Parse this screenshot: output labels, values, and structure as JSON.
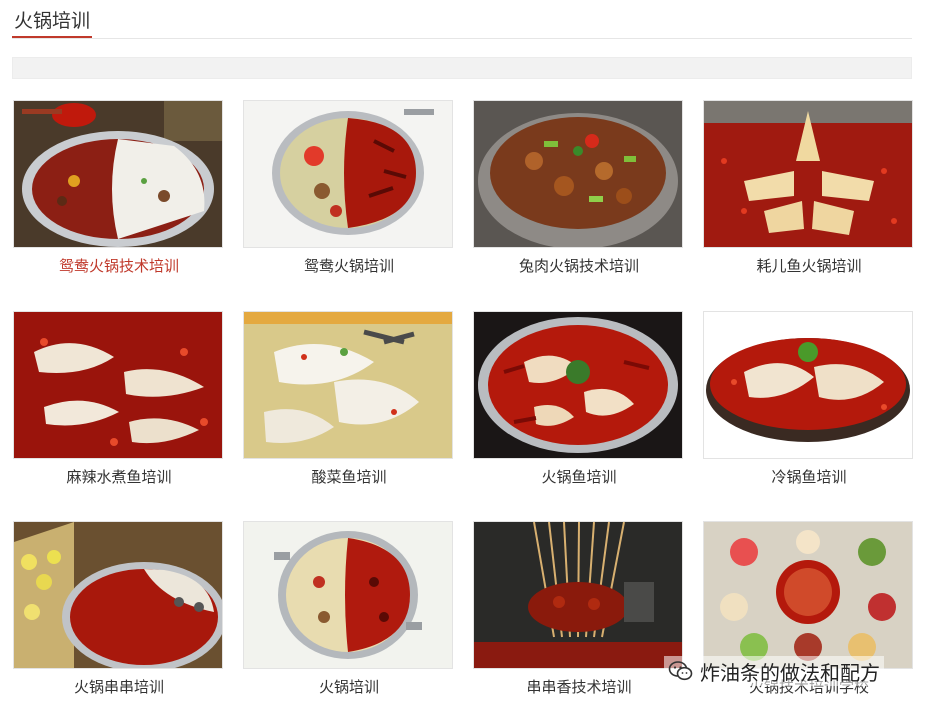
{
  "header": {
    "title": "火锅培训"
  },
  "items": [
    {
      "label": "鸳鸯火锅技术培训",
      "image": "yuanyang-hotpot-photo"
    },
    {
      "label": "鸳鸯火锅培训",
      "image": "yuanyang-pot-photo"
    },
    {
      "label": "兔肉火锅技术培训",
      "image": "rabbit-hotpot-photo"
    },
    {
      "label": "耗儿鱼火锅培训",
      "image": "haoer-fish-hotpot-photo"
    },
    {
      "label": "麻辣水煮鱼培训",
      "image": "spicy-boiled-fish-photo"
    },
    {
      "label": "酸菜鱼培训",
      "image": "pickled-cabbage-fish-photo"
    },
    {
      "label": "火锅鱼培训",
      "image": "fish-hotpot-photo"
    },
    {
      "label": "冷锅鱼培训",
      "image": "cold-pot-fish-photo"
    },
    {
      "label": "火锅串串培训",
      "image": "chuanchuan-hotpot-photo"
    },
    {
      "label": "火锅培训",
      "image": "hotpot-photo"
    },
    {
      "label": "串串香技术培训",
      "image": "chuanchuan-skewers-photo"
    },
    {
      "label": "火锅技术培训学校",
      "image": "hotpot-school-photo"
    }
  ],
  "watermark": {
    "text": "炸油条的做法和配方",
    "icon": "wechat-icon"
  },
  "colors": {
    "accent": "#c0392b",
    "text": "#333333",
    "broth_red": "#b8160f",
    "pot_steel": "#b9bcc0"
  }
}
